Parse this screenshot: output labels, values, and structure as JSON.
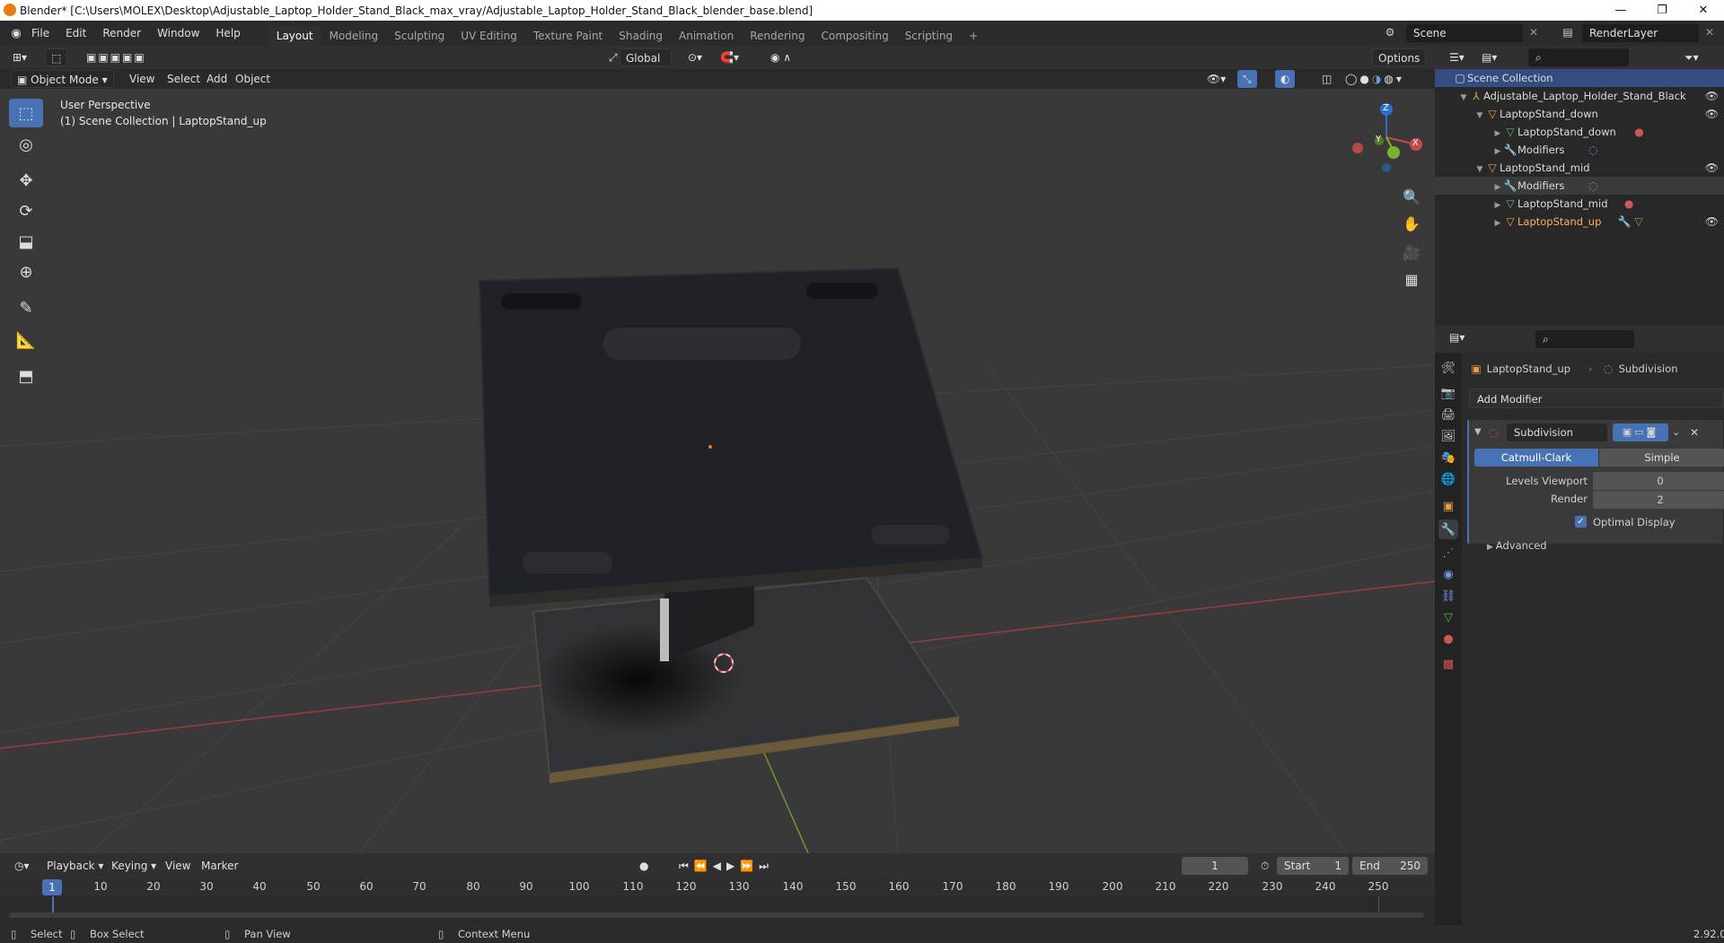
{
  "window": {
    "title": "Blender* [C:\\Users\\MOLEX\\Desktop\\Adjustable_Laptop_Holder_Stand_Black_max_vray/Adjustable_Laptop_Holder_Stand_Black_blender_base.blend]",
    "minimize": "—",
    "restore": "❐",
    "close": "✕"
  },
  "menus": [
    "File",
    "Edit",
    "Render",
    "Window",
    "Help"
  ],
  "workspaces": [
    "Layout",
    "Modeling",
    "Sculpting",
    "UV Editing",
    "Texture Paint",
    "Shading",
    "Animation",
    "Rendering",
    "Compositing",
    "Scripting"
  ],
  "workspace_add": "+",
  "scene": {
    "name": "Scene",
    "render_layer": "RenderLayer"
  },
  "toolheader": {
    "transform": "Global",
    "options": "Options"
  },
  "viewheader": {
    "mode": "Object Mode",
    "items": [
      "View",
      "Select",
      "Add",
      "Object"
    ]
  },
  "viewport": {
    "perspective": "User Perspective",
    "collection_info": "(1) Scene Collection | LaptopStand_up",
    "gizmo": {
      "x": "X",
      "y": "Y",
      "z": "Z"
    }
  },
  "outliner": {
    "rows": [
      {
        "label": "Scene Collection",
        "icon": "collection-icon"
      },
      {
        "label": "Adjustable_Laptop_Holder_Stand_Black",
        "icon": "armature-icon"
      },
      {
        "label": "LaptopStand_down",
        "icon": "object-icon"
      },
      {
        "label": "LaptopStand_down",
        "icon": "mesh-icon"
      },
      {
        "label": "Modifiers",
        "icon": "wrench-icon"
      },
      {
        "label": "LaptopStand_mid",
        "icon": "object-icon"
      },
      {
        "label": "Modifiers",
        "icon": "wrench-icon"
      },
      {
        "label": "LaptopStand_mid",
        "icon": "mesh-icon"
      },
      {
        "label": "LaptopStand_up",
        "icon": "object-icon"
      }
    ]
  },
  "properties": {
    "object": "LaptopStand_up",
    "modifier_ref": "Subdivision",
    "add_modifier": "Add Modifier",
    "modifier": {
      "name": "Subdivision",
      "type_a": "Catmull-Clark",
      "type_b": "Simple",
      "levels_viewport_label": "Levels Viewport",
      "levels_viewport": "0",
      "render_label": "Render",
      "render": "2",
      "optimal_display": "Optimal Display",
      "advanced": "Advanced"
    }
  },
  "timeline": {
    "menus": [
      "Playback",
      "Keying",
      "View",
      "Marker"
    ],
    "current_frame": "1",
    "start_label": "Start",
    "start": "1",
    "end_label": "End",
    "end": "250",
    "ticks": [
      "1",
      "10",
      "20",
      "30",
      "40",
      "50",
      "60",
      "70",
      "80",
      "90",
      "100",
      "110",
      "120",
      "130",
      "140",
      "150",
      "160",
      "170",
      "180",
      "190",
      "200",
      "210",
      "220",
      "230",
      "240",
      "250"
    ]
  },
  "statusbar": {
    "select": "Select",
    "box_select": "Box Select",
    "pan_view": "Pan View",
    "context_menu": "Context Menu",
    "version": "2.92.0"
  },
  "colors": {
    "accent": "#4772b3",
    "viewport_bg": "#393939",
    "x_axis": "#c24b4b",
    "y_axis": "#7ab330",
    "z_axis": "#2a6fd1",
    "object_orange": "#e87d0d"
  }
}
